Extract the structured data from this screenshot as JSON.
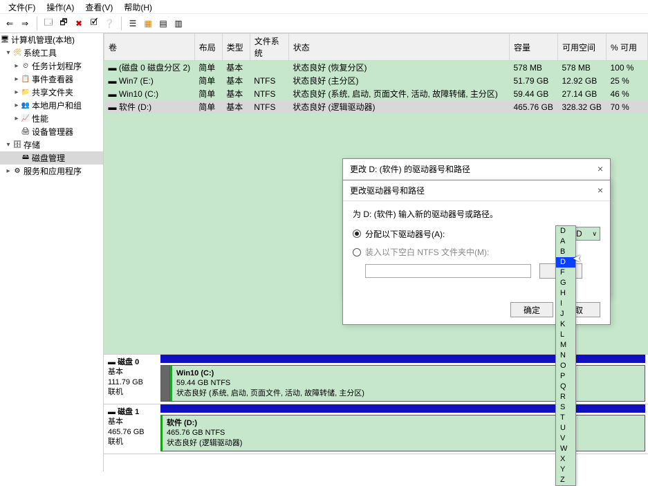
{
  "menu": {
    "file": "文件(F)",
    "action": "操作(A)",
    "view": "查看(V)",
    "help": "帮助(H)"
  },
  "tree": {
    "root": "计算机管理(本地)",
    "systools": "系统工具",
    "scheduler": "任务计划程序",
    "eventviewer": "事件查看器",
    "sharedfolders": "共享文件夹",
    "localusers": "本地用户和组",
    "performance": "性能",
    "devicemgr": "设备管理器",
    "storage": "存储",
    "diskmgmt": "磁盘管理",
    "services": "服务和应用程序"
  },
  "cols": {
    "volume": "卷",
    "layout": "布局",
    "type": "类型",
    "fs": "文件系统",
    "status": "状态",
    "capacity": "容量",
    "free": "可用空间",
    "pctfree": "% 可用"
  },
  "rows": [
    {
      "d": "▬",
      "vol": "(磁盘 0 磁盘分区 2)",
      "layout": "简单",
      "type": "基本",
      "fs": "",
      "status": "状态良好 (恢复分区)",
      "cap": "578 MB",
      "free": "578 MB",
      "pct": "100 %"
    },
    {
      "d": "▬",
      "vol": "Win7 (E:)",
      "layout": "简单",
      "type": "基本",
      "fs": "NTFS",
      "status": "状态良好 (主分区)",
      "cap": "51.79 GB",
      "free": "12.92 GB",
      "pct": "25 %"
    },
    {
      "d": "▬",
      "vol": "Win10 (C:)",
      "layout": "简单",
      "type": "基本",
      "fs": "NTFS",
      "status": "状态良好 (系统, 启动, 页面文件, 活动, 故障转储, 主分区)",
      "cap": "59.44 GB",
      "free": "27.14 GB",
      "pct": "46 %"
    },
    {
      "d": "▬",
      "vol": "软件 (D:)",
      "layout": "简单",
      "type": "基本",
      "fs": "NTFS",
      "status": "状态良好 (逻辑驱动器)",
      "cap": "465.76 GB",
      "free": "328.32 GB",
      "pct": "70 %"
    }
  ],
  "disk0": {
    "name": "磁盘 0",
    "type": "基本",
    "size": "111.79 GB",
    "state": "联机",
    "vol_name": "Win10  (C:)",
    "vol_size": "59.44 GB NTFS",
    "vol_status": "状态良好 (系统, 启动, 页面文件, 活动, 故障转储, 主分区)"
  },
  "disk1": {
    "name": "磁盘 1",
    "type": "基本",
    "size": "465.76 GB",
    "state": "联机",
    "vol_name": "软件  (D:)",
    "vol_size": "465.76 GB NTFS",
    "vol_status": "状态良好 (逻辑驱动器)"
  },
  "dlg1": {
    "title": "更改 D: (软件) 的驱动器号和路径",
    "ok": "确定",
    "cancel": "取"
  },
  "dlg2": {
    "title": "更改驱动器号和路径",
    "prompt": "为 D: (软件) 输入新的驱动器号或路径。",
    "radio1": "分配以下驱动器号(A):",
    "radio2": "装入以下空白 NTFS 文件夹中(M):",
    "browse": "浏",
    "selected_letter": "D",
    "ok": "确定",
    "cancel": "取"
  },
  "letters": [
    "D",
    "A",
    "B",
    "D",
    "F",
    "G",
    "H",
    "I",
    "J",
    "K",
    "L",
    "M",
    "N",
    "O",
    "P",
    "Q",
    "R",
    "S",
    "T",
    "U",
    "V",
    "W",
    "X",
    "Y",
    "Z"
  ]
}
